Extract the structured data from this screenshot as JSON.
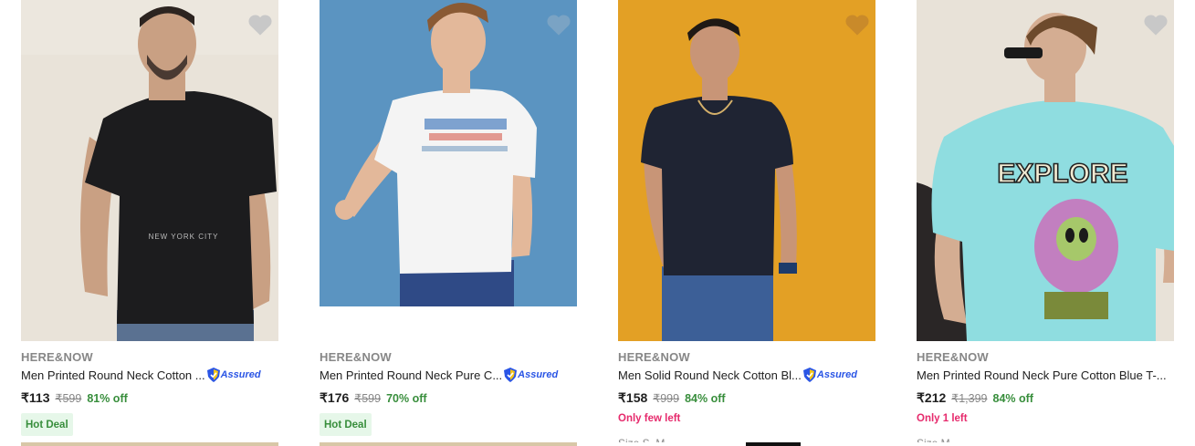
{
  "products": [
    {
      "brand": "HERE&NOW",
      "title": "Men Printed Round Neck Cotton ...",
      "assured": "Assured",
      "price": "₹113",
      "mrp": "₹599",
      "discount": "81% off",
      "tag": "Hot Deal",
      "tshirt_print": "NEW YORK CITY",
      "colors": {
        "bg": "#e9e3d9",
        "shirt": "#1c1c1e"
      }
    },
    {
      "brand": "HERE&NOW",
      "title": "Men Printed Round Neck Pure C...",
      "assured": "Assured",
      "price": "₹176",
      "mrp": "₹599",
      "discount": "70% off",
      "tag": "Hot Deal",
      "colors": {
        "bg": "#5b94c1",
        "shirt": "#f4f4f4"
      }
    },
    {
      "brand": "HERE&NOW",
      "title": "Men Solid Round Neck Cotton Bl...",
      "assured": "Assured",
      "price": "₹158",
      "mrp": "₹999",
      "discount": "84% off",
      "stock": "Only few left",
      "size": "Size S, M",
      "colors": {
        "bg": "#e3a025",
        "shirt": "#1f2433"
      }
    },
    {
      "brand": "HERE&NOW",
      "title": "Men Printed Round Neck Pure Cotton Blue T-...",
      "price": "₹212",
      "mrp": "₹1,399",
      "discount": "84% off",
      "stock": "Only 1 left",
      "size": "Size M",
      "tshirt_print": "EXPLORE",
      "colors": {
        "bg": "#e8e2d8",
        "shirt": "#8fdde0"
      }
    }
  ],
  "icons": {
    "wishlist": "heart-icon",
    "assured_badge": "shield-icon"
  }
}
